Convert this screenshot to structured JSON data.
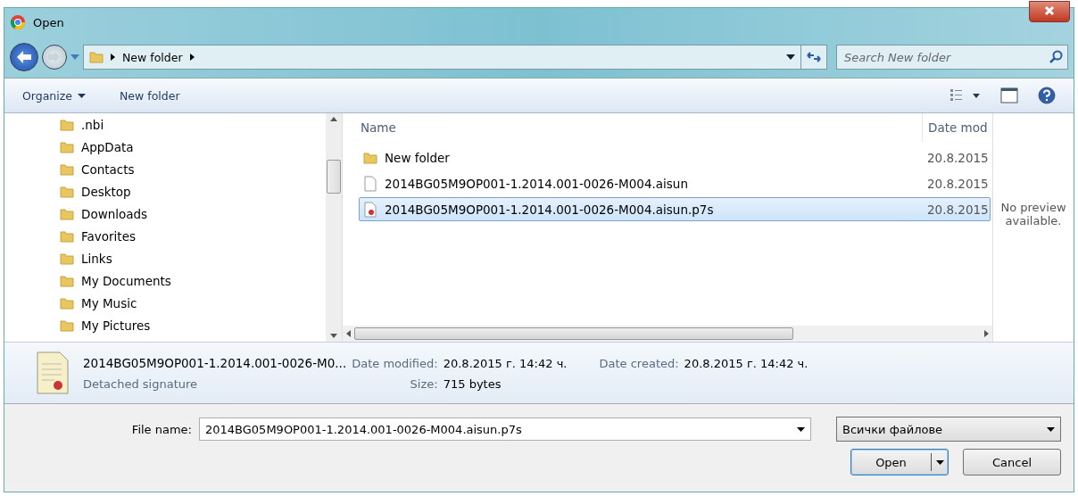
{
  "window": {
    "title": "Open"
  },
  "address": {
    "path": [
      "New folder"
    ],
    "search_placeholder": "Search New folder"
  },
  "toolbar": {
    "organize": "Organize",
    "new_folder": "New folder"
  },
  "sidebar": {
    "items": [
      {
        "label": ".nbi"
      },
      {
        "label": "AppData"
      },
      {
        "label": "Contacts"
      },
      {
        "label": "Desktop"
      },
      {
        "label": "Downloads"
      },
      {
        "label": "Favorites"
      },
      {
        "label": "Links"
      },
      {
        "label": "My Documents"
      },
      {
        "label": "My Music"
      },
      {
        "label": "My Pictures"
      }
    ]
  },
  "files": {
    "columns": [
      "Name",
      "Date mod"
    ],
    "rows": [
      {
        "kind": "folder",
        "name": "New folder",
        "date": "20.8.2015",
        "selected": false
      },
      {
        "kind": "file",
        "name": "2014BG05M9OP001-1.2014.001-0026-M004.aisun",
        "date": "20.8.2015",
        "selected": false
      },
      {
        "kind": "signature",
        "name": "2014BG05M9OP001-1.2014.001-0026-M004.aisun.p7s",
        "date": "20.8.2015",
        "selected": true
      }
    ]
  },
  "preview": {
    "message": "No preview available."
  },
  "details": {
    "name": "2014BG05M9OP001-1.2014.001-0026-M0...",
    "type": "Detached signature",
    "fields": [
      {
        "label": "Date modified:",
        "value": "20.8.2015 г. 14:42 ч."
      },
      {
        "label": "Size:",
        "value": "715 bytes"
      },
      {
        "label": "Date created:",
        "value": "20.8.2015 г. 14:42 ч."
      }
    ]
  },
  "footer": {
    "file_name_label": "File name:",
    "file_name": "2014BG05M9OP001-1.2014.001-0026-M004.aisun.p7s",
    "filter": "Всички файлове",
    "open": "Open",
    "cancel": "Cancel"
  }
}
